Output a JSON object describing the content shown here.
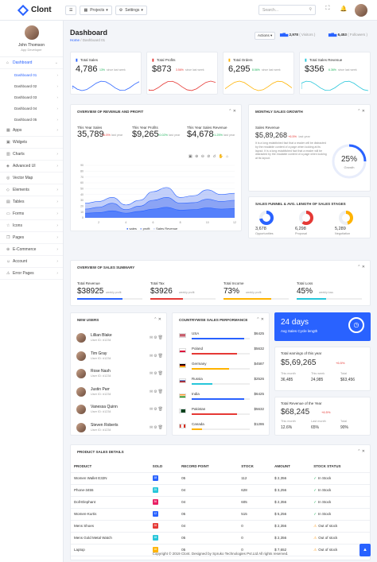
{
  "brand": "Clont",
  "header": {
    "projects": "Projects",
    "settings": "Settings",
    "search_placeholder": "Search...",
    "menu_icon": "hamburger-icon"
  },
  "sidebar": {
    "user_name": "John Thomson",
    "user_role": "App Developer",
    "items": [
      {
        "label": "Dashboard",
        "icon": "home-icon"
      }
    ],
    "subitems": [
      "Dashboard 01",
      "Dashboard 02",
      "Dashboard 03",
      "Dashboard 04",
      "Dashboard 05"
    ],
    "menu": [
      {
        "label": "Apps"
      },
      {
        "label": "Widgets"
      },
      {
        "label": "Charts"
      },
      {
        "label": "Advanced UI"
      },
      {
        "label": "Vector Map"
      },
      {
        "label": "Elements"
      },
      {
        "label": "Tables"
      },
      {
        "label": "Forms"
      },
      {
        "label": "Icons"
      },
      {
        "label": "Pages"
      },
      {
        "label": "E-Commerce"
      },
      {
        "label": "Account"
      },
      {
        "label": "Error Pages"
      }
    ]
  },
  "page": {
    "title": "Dashboard",
    "crumb_home": "Home",
    "crumb_sep": "/",
    "crumb_current": "Dashboard 01",
    "actions": "Actions",
    "visitors_val": "2,978",
    "visitors_lbl": "( Visitors )",
    "followers_val": "6,453",
    "followers_lbl": "( Followers )"
  },
  "stats": [
    {
      "title": "Total Sales",
      "value": "4,786",
      "change": "13%",
      "since": "since last week",
      "color": "#2962ff"
    },
    {
      "title": "Total Profits",
      "value": "$873",
      "change": "3.56%",
      "since": "since last week",
      "color": "#e53935"
    },
    {
      "title": "Total Orders",
      "value": "6,295",
      "change": "8.56%",
      "since": "since last week",
      "color": "#ffb300"
    },
    {
      "title": "Total Sales Revenue",
      "value": "$356",
      "change": "6.36%",
      "since": "since last week",
      "color": "#26c6da"
    }
  ],
  "revenue": {
    "title": "Overview of Revenue and Profit",
    "k1_label": "This Year Sales",
    "k1_value": "35,789",
    "k1_change": "+6.5%",
    "k1_since": "last year",
    "k2_label": "This Year Profits",
    "k2_value": "$9,265",
    "k2_change": "+0.02%",
    "k2_since": "last year",
    "k3_label": "This Year Sales Revenue",
    "k3_value": "$4,678",
    "k3_change": "+1.25%",
    "k3_since": "last year",
    "legend": [
      "sales",
      "profit",
      "Sales Revenue"
    ]
  },
  "chart_data": {
    "type": "area",
    "x": [
      1,
      2,
      3,
      4,
      5,
      6,
      7,
      8,
      9,
      10,
      11,
      12
    ],
    "xticks": [
      2,
      4,
      6,
      8,
      10,
      12
    ],
    "ylim": [
      0,
      90
    ],
    "yticks": [
      0,
      10,
      20,
      30,
      40,
      50,
      60,
      70,
      80,
      90
    ],
    "series": [
      {
        "name": "sales",
        "values": [
          25,
          28,
          35,
          22,
          30,
          45,
          52,
          35,
          38,
          48,
          40,
          42
        ]
      },
      {
        "name": "profit",
        "values": [
          15,
          18,
          25,
          14,
          20,
          30,
          35,
          25,
          26,
          32,
          28,
          30
        ]
      },
      {
        "name": "Sales Revenue",
        "values": [
          8,
          9,
          12,
          8,
          11,
          15,
          18,
          13,
          14,
          17,
          15,
          16
        ]
      }
    ]
  },
  "monthly": {
    "title": "Monthly Sales Growth",
    "label": "Sales Revenue",
    "value": "$5,89,268",
    "change": "+6.5%",
    "since": "last year",
    "text": "It is a long established fact that a reader will be distracted by the readable content of a page when looking at its layout. It is a long established fact that a reader will be distracted by the readable content of a page when looking at its layout.",
    "pct": "25%",
    "pct_label": "Growth"
  },
  "funnel": {
    "title": "Sales Funnel & Avg. Length of Sales Stages",
    "items": [
      {
        "value": "3,678",
        "label": "Opportunities"
      },
      {
        "value": "6,298",
        "label": "Proposal"
      },
      {
        "value": "5,289",
        "label": "Negotiation"
      }
    ]
  },
  "summary": {
    "title": "Overview of Sales Summary",
    "items": [
      {
        "label": "Total Revenue",
        "value": "$38925",
        "sub": "weekly profit",
        "color": "#2962ff"
      },
      {
        "label": "Total Tax",
        "value": "$3926",
        "sub": "weekly profit",
        "color": "#e53935"
      },
      {
        "label": "Total Income",
        "value": "73%",
        "sub": "weekly profit",
        "color": "#ffb300"
      },
      {
        "label": "Total Loss",
        "value": "45%",
        "sub": "weekly loss",
        "color": "#26c6da"
      }
    ]
  },
  "users": {
    "title": "New Users",
    "list": [
      {
        "name": "Lillian Blake",
        "id": "User ID: #1234"
      },
      {
        "name": "Tim Gray",
        "id": "User ID: #1234"
      },
      {
        "name": "Rose Nash",
        "id": "User ID: #1234"
      },
      {
        "name": "Justin Parr",
        "id": "User ID: #1234"
      },
      {
        "name": "Vanessa Quinn",
        "id": "User ID: #1234"
      },
      {
        "name": "Steven Roberts",
        "id": "User ID: #1234"
      }
    ]
  },
  "countries": {
    "title": "Countrywise Sales Performance",
    "list": [
      {
        "name": "USA",
        "value": "$6425",
        "color": "#2962ff"
      },
      {
        "name": "Poland",
        "value": "$5632",
        "color": "#e53935"
      },
      {
        "name": "Germany",
        "value": "$4587",
        "color": "#ffb300"
      },
      {
        "name": "Russia",
        "value": "$2526",
        "color": "#26c6da"
      },
      {
        "name": "India",
        "value": "$6425",
        "color": "#2962ff"
      },
      {
        "name": "Pakistan",
        "value": "$5632",
        "color": "#e53935"
      },
      {
        "name": "Canada",
        "value": "$1286",
        "color": "#ffb300"
      }
    ]
  },
  "cycle": {
    "value": "24 days",
    "label": "Avg Sales Cycle length"
  },
  "earnings": {
    "label": "Total earnings of this year",
    "value": "$5,69,265",
    "change": "+6.5%",
    "m_lbl": "This month",
    "m_val": "36,485",
    "w_lbl": "This week",
    "w_val": "24,985",
    "t_lbl": "Total",
    "t_val": "$63,456"
  },
  "yearrev": {
    "label": "Total Revenue of the Year",
    "value": "$68,245",
    "change": "+6.5%",
    "m_lbl": "This month",
    "m_val": "12.6%",
    "w_lbl": "Last month",
    "w_val": "65%",
    "t_lbl": "Total",
    "t_val": "90%"
  },
  "products": {
    "title": "Product Sales Details",
    "headers": [
      "PRODUCT",
      "SOLD",
      "RECORD POINT",
      "STOCK",
      "AMOUNT",
      "STOCK STATUS"
    ],
    "rows": [
      {
        "product": "Women Wallet E32N",
        "sold": "18",
        "sold_color": "#2962ff",
        "record": "05",
        "stock": "112",
        "amount": "$ 2,356",
        "status": "In Stock",
        "ok": true
      },
      {
        "product": "Phone-3455",
        "sold": "25",
        "sold_color": "#26c6da",
        "record": "04",
        "stock": "628",
        "amount": "$ 3,256",
        "status": "In Stock",
        "ok": true
      },
      {
        "product": "Doll-Elephant",
        "sold": "36",
        "sold_color": "#e91e63",
        "record": "04",
        "stock": "605",
        "amount": "$ 2,356",
        "status": "In Stock",
        "ok": true
      },
      {
        "product": "Women-Kurtis",
        "sold": "12",
        "sold_color": "#2962ff",
        "record": "05",
        "stock": "515",
        "amount": "$ 5,256",
        "status": "In Stock",
        "ok": true
      },
      {
        "product": "Mens Shoes",
        "sold": "26",
        "sold_color": "#e53935",
        "record": "04",
        "stock": "0",
        "amount": "$ 2,356",
        "status": "Out of stock",
        "ok": false
      },
      {
        "product": "Mens Gold Metal Watch",
        "sold": "18",
        "sold_color": "#26c6da",
        "record": "05",
        "stock": "0",
        "amount": "$ 2,356",
        "status": "Out of stock",
        "ok": false
      },
      {
        "product": "Laptop",
        "sold": "16",
        "sold_color": "#ffb300",
        "record": "05",
        "stock": "0",
        "amount": "$ 7,652",
        "status": "Out of stock",
        "ok": false
      }
    ]
  },
  "footer": "Copyright © 2019 Clont. Designed by Spruko Technologies Pvt.Ltd All rights reserved."
}
